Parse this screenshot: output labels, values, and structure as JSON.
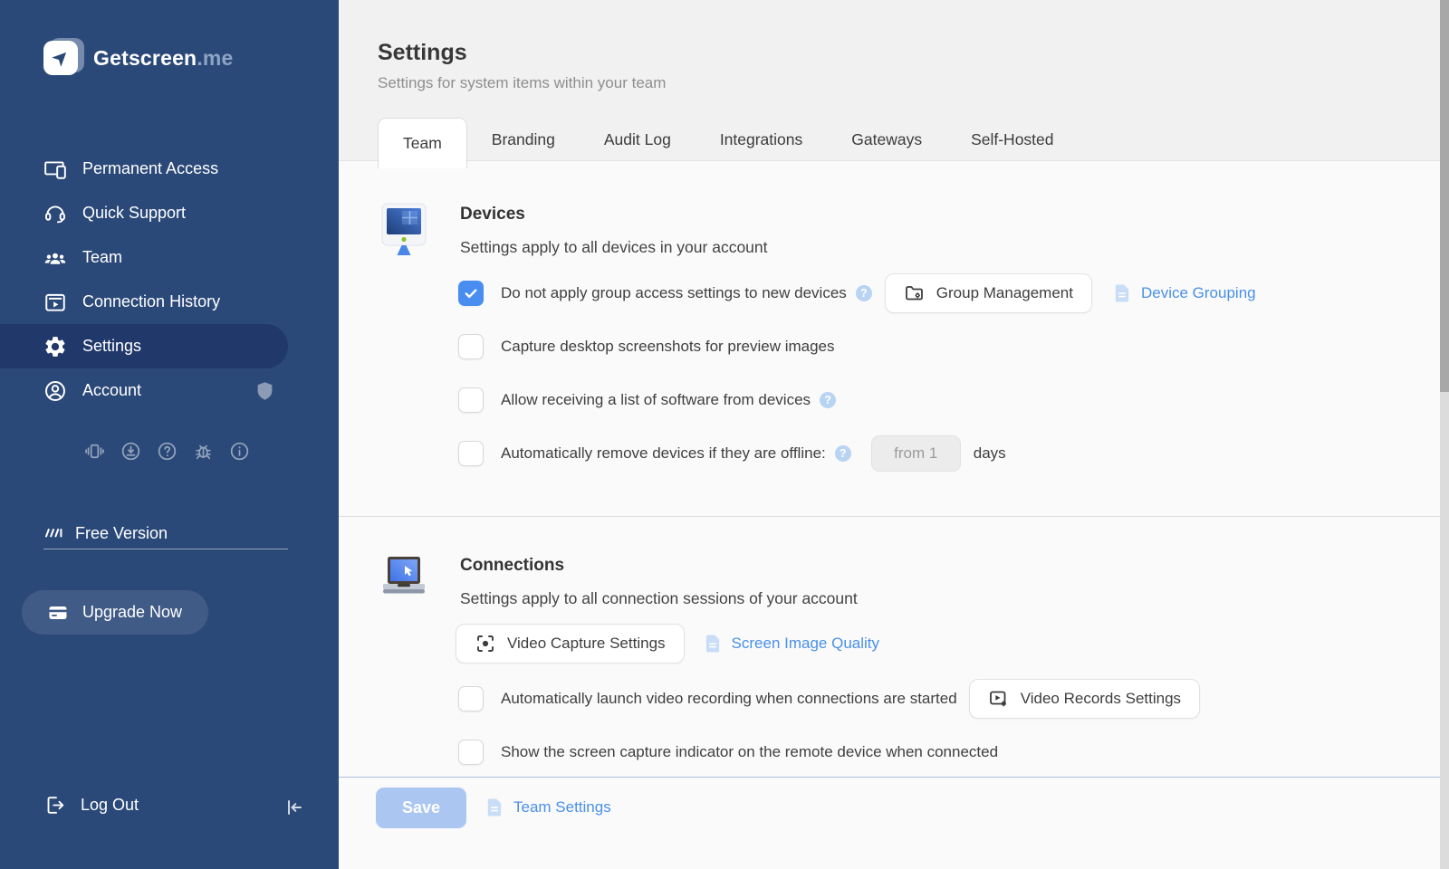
{
  "brand": {
    "name": "Getscreen",
    "suffix": ".me",
    "logo_glyph": "➤"
  },
  "colors": {
    "sidebar": "#2b4978",
    "sidebar_active": "#21386b",
    "accent": "#4a8df0",
    "link": "#4a90e8",
    "save_disabled": "#abc7f1"
  },
  "sidebar": {
    "nav": [
      {
        "label": "Permanent Access"
      },
      {
        "label": "Quick Support"
      },
      {
        "label": "Team"
      },
      {
        "label": "Connection History"
      },
      {
        "label": "Settings",
        "active": true
      },
      {
        "label": "Account"
      }
    ],
    "utility_icons": [
      "devices-icon",
      "download-icon",
      "help-icon",
      "bug-icon",
      "info-icon"
    ],
    "plan_label": "Free Version",
    "upgrade_label": "Upgrade Now",
    "logout_label": "Log Out"
  },
  "header": {
    "title": "Settings",
    "subtitle": "Settings for system items within your team",
    "tabs": [
      {
        "label": "Team",
        "active": true
      },
      {
        "label": "Branding",
        "active": false
      },
      {
        "label": "Audit Log",
        "active": false
      },
      {
        "label": "Integrations",
        "active": false
      },
      {
        "label": "Gateways",
        "active": false
      },
      {
        "label": "Self-Hosted",
        "active": false
      }
    ]
  },
  "devices": {
    "title": "Devices",
    "subtitle": "Settings apply to all devices in your account",
    "rows": [
      {
        "label": "Do not apply group access settings to new devices",
        "checked": true,
        "help": true
      },
      {
        "label": "Capture desktop screenshots for preview images",
        "checked": false
      },
      {
        "label": "Allow receiving a list of software from devices",
        "checked": false,
        "help": true
      },
      {
        "label": "Automatically remove devices if they are offline:",
        "checked": false,
        "help": true,
        "input_value": "from 1",
        "unit": "days"
      }
    ],
    "group_management_button": "Group Management",
    "device_grouping_link": "Device Grouping"
  },
  "connections": {
    "title": "Connections",
    "subtitle": "Settings apply to all connection sessions of your account",
    "video_capture_button": "Video Capture Settings",
    "screen_quality_link": "Screen Image Quality",
    "rows": [
      {
        "label": "Automatically launch video recording when connections are started",
        "checked": false,
        "button": "Video Records Settings"
      },
      {
        "label": "Show the screen capture indicator on the remote device when connected",
        "checked": false
      }
    ]
  },
  "footer": {
    "save_button": "Save",
    "team_settings_link": "Team Settings"
  },
  "help_glyph": "?"
}
